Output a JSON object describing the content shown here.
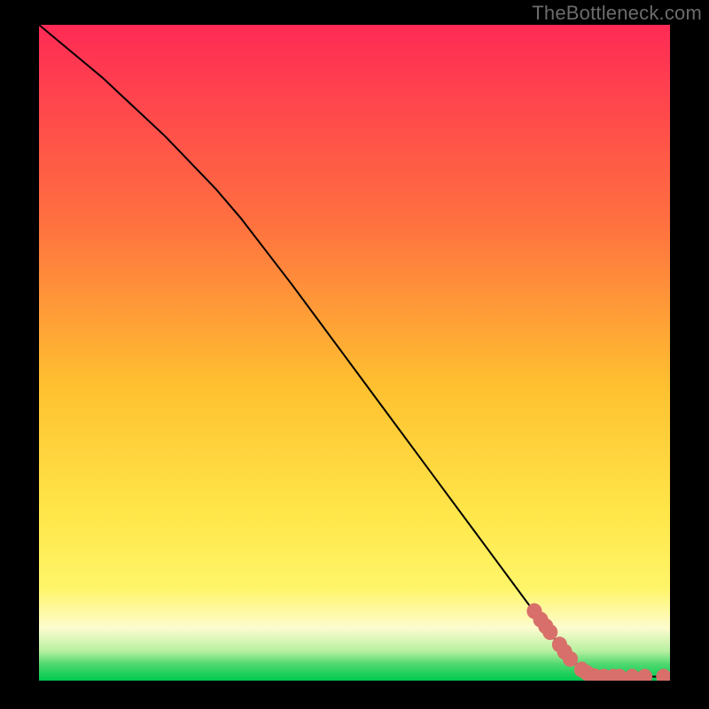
{
  "watermark": "TheBottleneck.com",
  "colors": {
    "frame": "#000000",
    "watermark": "#6b6b6b",
    "curve": "#000000",
    "dots": "#d86f6a",
    "bg_top": "#ff2a55",
    "bg_mid1": "#ff8040",
    "bg_mid2": "#ffd040",
    "bg_yellow": "#fff050",
    "bg_pale": "#fdfccf",
    "bg_lightgreen": "#8fe88f",
    "bg_green": "#00c94f"
  },
  "chart_data": {
    "type": "line",
    "title": "",
    "xlabel": "",
    "ylabel": "",
    "xlim": [
      0,
      100
    ],
    "ylim": [
      0,
      100
    ],
    "curve": {
      "name": "bottleneck-curve",
      "x": [
        0,
        5,
        10,
        15,
        20,
        25,
        28,
        32,
        36,
        40,
        45,
        50,
        55,
        60,
        65,
        70,
        75,
        80,
        82,
        84,
        86,
        87.5,
        89,
        91,
        93,
        95,
        97,
        100
      ],
      "y": [
        100,
        96,
        92,
        87.5,
        83,
        78,
        75,
        70.5,
        65.5,
        60.5,
        54,
        47.5,
        41,
        34.5,
        28,
        21.5,
        15,
        8.5,
        6,
        3.5,
        1.8,
        1.0,
        0.6,
        0.6,
        0.6,
        0.6,
        0.6,
        0.6
      ]
    },
    "dots": {
      "name": "threshold-dots",
      "points": [
        {
          "x": 78.5,
          "y": 10.6
        },
        {
          "x": 79.5,
          "y": 9.3
        },
        {
          "x": 80.3,
          "y": 8.3
        },
        {
          "x": 81.0,
          "y": 7.4
        },
        {
          "x": 82.5,
          "y": 5.5
        },
        {
          "x": 83.3,
          "y": 4.4
        },
        {
          "x": 84.2,
          "y": 3.3
        },
        {
          "x": 86.0,
          "y": 1.7
        },
        {
          "x": 86.8,
          "y": 1.2
        },
        {
          "x": 88.0,
          "y": 0.7
        },
        {
          "x": 89.5,
          "y": 0.6
        },
        {
          "x": 91.0,
          "y": 0.6
        },
        {
          "x": 92.0,
          "y": 0.6
        },
        {
          "x": 94.0,
          "y": 0.6
        },
        {
          "x": 96.0,
          "y": 0.6
        },
        {
          "x": 99.0,
          "y": 0.6
        }
      ],
      "radius": 1.2
    },
    "background_gradient_stops": [
      {
        "offset": 0.0,
        "color": "#ff2a55"
      },
      {
        "offset": 0.3,
        "color": "#ff7040"
      },
      {
        "offset": 0.55,
        "color": "#ffc030"
      },
      {
        "offset": 0.75,
        "color": "#ffe74a"
      },
      {
        "offset": 0.86,
        "color": "#fff56a"
      },
      {
        "offset": 0.92,
        "color": "#fdfccf"
      },
      {
        "offset": 0.955,
        "color": "#b6f0a0"
      },
      {
        "offset": 0.975,
        "color": "#4fd96f"
      },
      {
        "offset": 1.0,
        "color": "#00c94f"
      }
    ]
  }
}
